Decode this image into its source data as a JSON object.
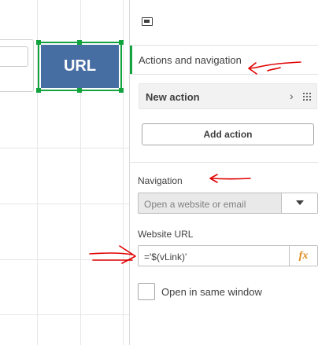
{
  "canvas": {
    "url_button_label": "URL",
    "url_button_color": "#476ea3",
    "selection_color": "#12a33f"
  },
  "panel": {
    "top_icon": "layout-toggle-icon",
    "section_title": "Actions and navigation",
    "new_action_label": "New action",
    "new_action_chevron": "›",
    "add_action_label": "Add action",
    "navigation_label": "Navigation",
    "navigation_value": "Open a website or email",
    "website_url_label": "Website URL",
    "website_url_value": "='$(vLink)'",
    "fx_label": "fx",
    "open_same_window_label": "Open in same window",
    "open_same_window_checked": false
  },
  "annotations": {
    "arrow_color": "#e00000"
  }
}
